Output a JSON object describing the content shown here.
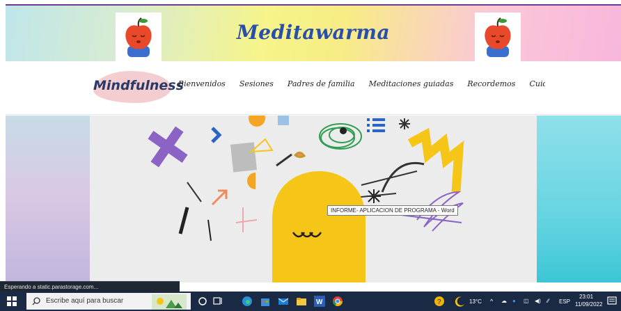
{
  "header": {
    "site_title": "Meditawarma"
  },
  "nav": {
    "brand": "Mindfulness",
    "items": [
      {
        "label": "Bienvenidos"
      },
      {
        "label": "Sesiones"
      },
      {
        "label": "Padres de familia"
      },
      {
        "label": "Meditaciones guiadas"
      },
      {
        "label": "Recordemos"
      },
      {
        "label": "Cuidado de la s"
      }
    ]
  },
  "tooltip": {
    "text": "INFORME- APLICACION DE PROGRAMA - Word"
  },
  "browser_status": {
    "text": "Esperando a static.parastorage.com..."
  },
  "taskbar": {
    "search_placeholder": "Escribe aquí para buscar",
    "temperature": "13°C",
    "language": "ESP",
    "time": "23:01",
    "date": "11/09/2022"
  },
  "colors": {
    "title_blue": "#2a4fa8",
    "taskbar": "#1b2a44",
    "mascot_yellow": "#f5c518",
    "side_right": "#67d4e2"
  },
  "icons": [
    "apple-logo-icon",
    "windows-start-icon",
    "search-icon",
    "cortana-icon",
    "task-view-icon",
    "edge-icon",
    "store-icon",
    "mail-icon",
    "file-explorer-icon",
    "word-icon",
    "chrome-icon",
    "help-icon",
    "weather-moon-icon",
    "notification-icon"
  ]
}
